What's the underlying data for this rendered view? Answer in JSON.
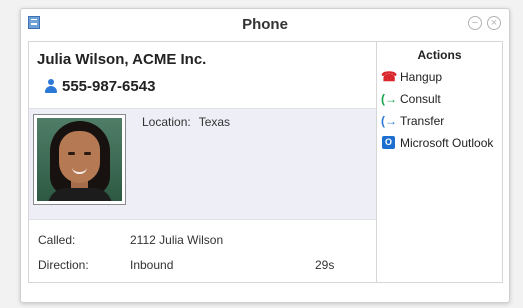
{
  "window": {
    "title": "Phone"
  },
  "contact": {
    "name": "Julia Wilson, ACME Inc.",
    "phone": "555-987-6543",
    "location_label": "Location:",
    "location_value": "Texas"
  },
  "details": {
    "called_label": "Called:",
    "called_value": "2112 Julia Wilson",
    "direction_label": "Direction:",
    "direction_value": "Inbound",
    "duration": "29s"
  },
  "actions": {
    "title": "Actions",
    "items": [
      {
        "label": "Hangup",
        "icon": "hangup-icon",
        "color": "#d9262c"
      },
      {
        "label": "Consult",
        "icon": "consult-icon",
        "color": "#16a34a"
      },
      {
        "label": "Transfer",
        "icon": "transfer-icon",
        "color": "#2b78d6"
      },
      {
        "label": "Microsoft Outlook",
        "icon": "outlook-icon",
        "color": "#1d6fcf"
      }
    ]
  }
}
